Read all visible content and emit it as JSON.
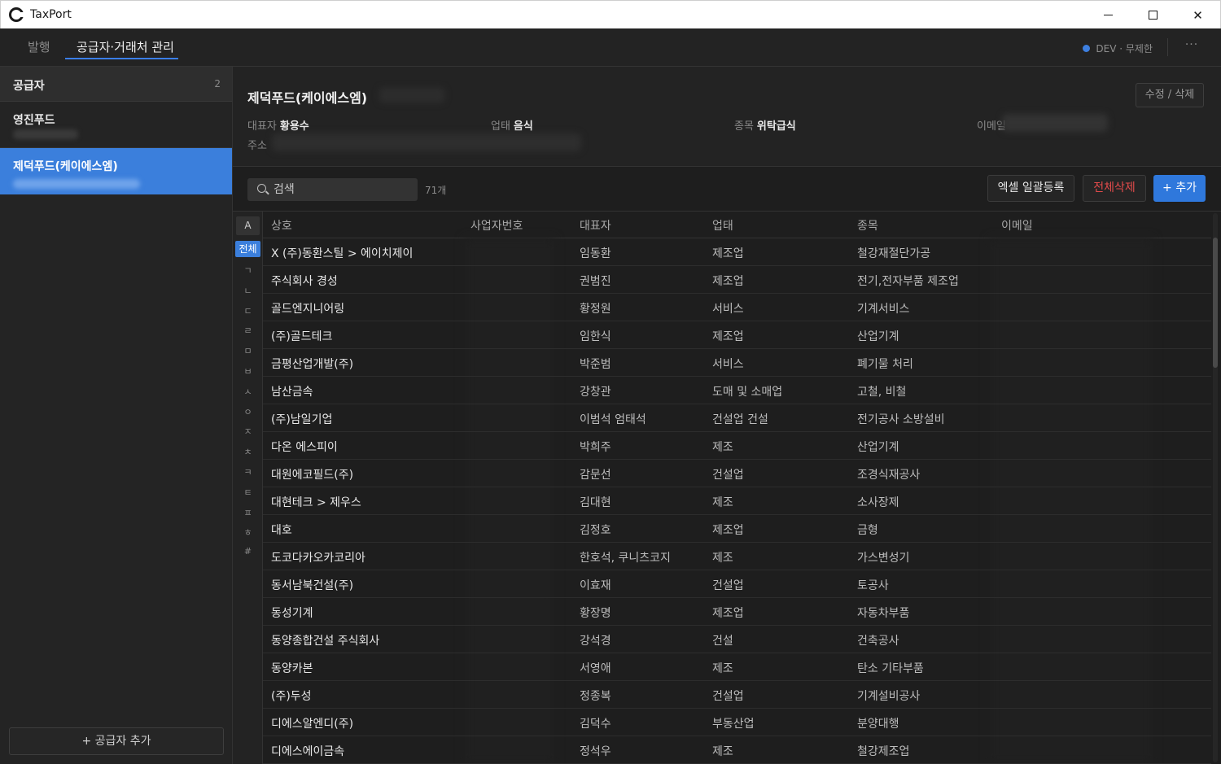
{
  "window": {
    "title": "TaxPort"
  },
  "tabs": [
    {
      "label": "발행",
      "active": false
    },
    {
      "label": "공급자·거래처 관리",
      "active": true
    }
  ],
  "status": {
    "text": "DEV · 무제한",
    "dot_color": "#3d7fe0"
  },
  "more_label": "···",
  "sidebar": {
    "title": "공급자",
    "count": "2",
    "items": [
      {
        "name": "영진푸드",
        "active": false
      },
      {
        "name": "제덕푸드(케이에스엠)",
        "active": true
      }
    ],
    "add_label": "+ 공급자 추가"
  },
  "detail": {
    "title": "제덕푸드(케이에스엠)",
    "edit_label": "수정 / 삭제",
    "rep_label": "대표자",
    "rep_value": "황용수",
    "biztype_label": "업태",
    "biztype_value": "음식",
    "item_label": "종목",
    "item_value": "위탁급식",
    "email_label": "이메일",
    "address_label": "주소"
  },
  "toolbar": {
    "search_placeholder": "검색",
    "count_text": "71개",
    "excel_label": "엑셀 일괄등록",
    "delete_all_label": "전체삭제",
    "add_label": "+ 추가",
    "delete_color": "#e24b4b",
    "accent_color": "#2f78dc"
  },
  "index": {
    "top_label": "A",
    "all_label": "전체",
    "letters": [
      "ㄱ",
      "ㄴ",
      "ㄷ",
      "ㄹ",
      "ㅁ",
      "ㅂ",
      "ㅅ",
      "ㅇ",
      "ㅈ",
      "ㅊ",
      "ㅋ",
      "ㅌ",
      "ㅍ",
      "ㅎ",
      "#"
    ]
  },
  "table": {
    "headers": {
      "name": "상호",
      "bizno": "사업자번호",
      "rep": "대표자",
      "type": "업태",
      "item": "종목",
      "email": "이메일"
    },
    "rows": [
      {
        "name": "X (주)동환스틸 > 에이치제이",
        "rep": "임동환",
        "type": "제조업",
        "item": "철강재절단가공"
      },
      {
        "name": "주식회사 경성",
        "rep": "권범진",
        "type": "제조업",
        "item": "전기,전자부품 제조업"
      },
      {
        "name": "골드엔지니어링",
        "rep": "황정원",
        "type": "서비스",
        "item": "기계서비스"
      },
      {
        "name": "(주)골드테크",
        "rep": "임한식",
        "type": "제조업",
        "item": "산업기계"
      },
      {
        "name": "금평산업개발(주)",
        "rep": "박준범",
        "type": "서비스",
        "item": "폐기물 처리"
      },
      {
        "name": "남산금속",
        "rep": "강창관",
        "type": "도매 및 소매업",
        "item": "고철, 비철"
      },
      {
        "name": "(주)남일기업",
        "rep": "이범석 엄태석",
        "type": "건설업 건설",
        "item": "전기공사 소방설비"
      },
      {
        "name": "다온 에스피이",
        "rep": "박희주",
        "type": "제조",
        "item": "산업기계"
      },
      {
        "name": "대원에코필드(주)",
        "rep": "감문선",
        "type": "건설업",
        "item": "조경식재공사"
      },
      {
        "name": "대현테크 > 제우스",
        "rep": "김대현",
        "type": "제조",
        "item": "소사장제"
      },
      {
        "name": "대호",
        "rep": "김정호",
        "type": "제조업",
        "item": "금형"
      },
      {
        "name": "도코다카오카코리아",
        "rep": "한호석, 쿠니츠코지",
        "type": "제조",
        "item": "가스변성기"
      },
      {
        "name": "동서남북건설(주)",
        "rep": "이효재",
        "type": "건설업",
        "item": "토공사"
      },
      {
        "name": "동성기계",
        "rep": "황장명",
        "type": "제조업",
        "item": "자동차부품"
      },
      {
        "name": "동양종합건설 주식회사",
        "rep": "강석경",
        "type": "건설",
        "item": "건축공사"
      },
      {
        "name": "동양카본",
        "rep": "서영애",
        "type": "제조",
        "item": "탄소 기타부품"
      },
      {
        "name": "(주)두성",
        "rep": "정종복",
        "type": "건설업",
        "item": "기계설비공사"
      },
      {
        "name": "디에스알엔디(주)",
        "rep": "김덕수",
        "type": "부동산업",
        "item": "분양대행"
      },
      {
        "name": "디에스에이금속",
        "rep": "정석우",
        "type": "제조",
        "item": "철강제조업"
      }
    ]
  }
}
